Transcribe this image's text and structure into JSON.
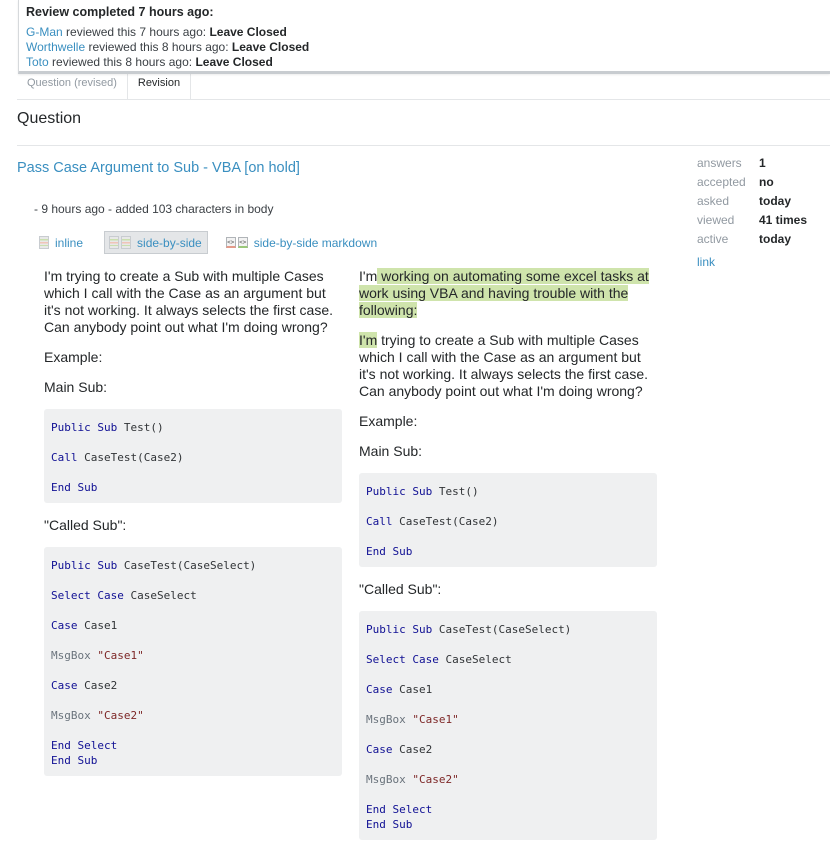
{
  "review": {
    "title": "Review completed 7 hours ago:",
    "entries": [
      {
        "user": "G-Man",
        "text": " reviewed this 7 hours ago: ",
        "result": "Leave Closed"
      },
      {
        "user": "Worthwelle",
        "text": " reviewed this 8 hours ago: ",
        "result": "Leave Closed"
      },
      {
        "user": "Toto",
        "text": " reviewed this 8 hours ago: ",
        "result": "Leave Closed"
      }
    ]
  },
  "tabs": [
    {
      "label": "Question (revised)",
      "active": false
    },
    {
      "label": "Revision",
      "active": true
    }
  ],
  "section_title": "Question",
  "question": {
    "title": "Pass Case Argument to Sub - VBA [on hold]",
    "revision_meta": "- 9 hours ago - added 103 characters in body"
  },
  "view_modes": [
    {
      "label": "inline",
      "selected": false
    },
    {
      "label": "side-by-side",
      "selected": true
    },
    {
      "label": "side-by-side markdown",
      "selected": false
    }
  ],
  "stats": [
    {
      "label": "answers",
      "value": "1"
    },
    {
      "label": "accepted",
      "value": "no"
    },
    {
      "label": "asked",
      "value": "today"
    },
    {
      "label": "viewed",
      "value": "41 times"
    },
    {
      "label": "active",
      "value": "today"
    }
  ],
  "stats_link": "link",
  "diff": {
    "left": {
      "intro": "I'm trying to create a Sub with multiple Cases which I call with the Case as an argument but it's not working. It always selects the first case. Can anybody point out what I'm doing wrong?",
      "example_label": "Example:",
      "main_sub_label": "Main Sub:",
      "called_sub_label": "\"Called Sub\":"
    },
    "right": {
      "added_prefix": "I'm",
      "added_text": " working on automating some excel tasks at work using VBA and having trouble with the following:",
      "added_im": "I'm",
      "intro_rest": " trying to create a Sub with multiple Cases which I call with the Case as an argument but it's not working. It always selects the first case. Can anybody point out what I'm doing wrong?",
      "example_label": "Example:",
      "main_sub_label": "Main Sub:",
      "called_sub_label": "\"Called Sub\":"
    },
    "code": {
      "main_sub": {
        "l1_kw": "Public Sub",
        "l1_rest": " Test()",
        "l2_kw": "Call",
        "l2_rest": " CaseTest(Case2)",
        "l3_kw": "End Sub"
      },
      "called_sub": {
        "l1_kw": "Public Sub",
        "l1_rest": " CaseTest(CaseSelect)",
        "l2_kw": "Select Case",
        "l2_rest": " CaseSelect",
        "l3_kw": "Case",
        "l3_rest": " Case1",
        "l4_id": "MsgBox",
        "l4_str": " \"Case1\"",
        "l5_kw": "Case",
        "l5_rest": " Case2",
        "l6_id": "MsgBox",
        "l6_str": " \"Case2\"",
        "l7_kw": "End Select",
        "l8_kw": "End Sub"
      }
    }
  }
}
